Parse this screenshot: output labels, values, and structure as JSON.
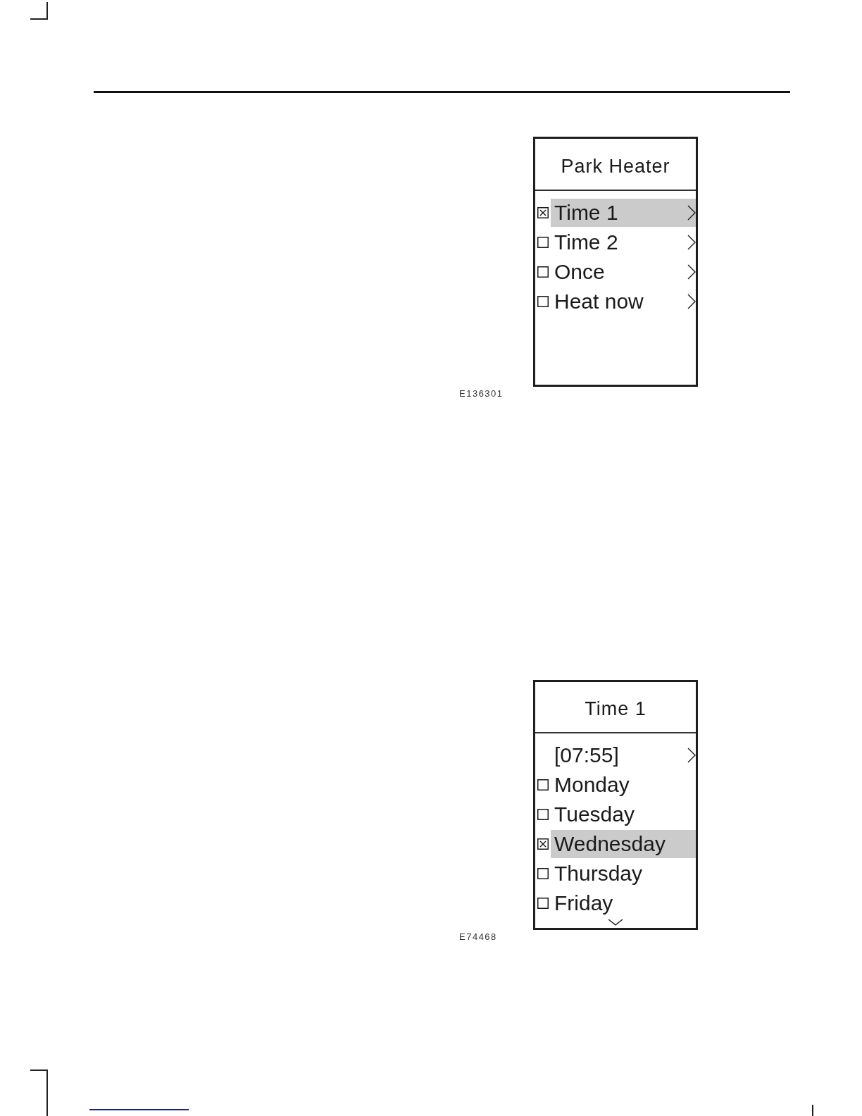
{
  "figures": [
    {
      "screen": {
        "title": "Park Heater",
        "items": [
          {
            "kind": "checkbox",
            "label": "Time 1",
            "checked": true,
            "selected": true,
            "submenu": true
          },
          {
            "kind": "checkbox",
            "label": "Time 2",
            "checked": false,
            "selected": false,
            "submenu": true
          },
          {
            "kind": "checkbox",
            "label": "Once",
            "checked": false,
            "selected": false,
            "submenu": true
          },
          {
            "kind": "checkbox",
            "label": "Heat now",
            "checked": false,
            "selected": false,
            "submenu": true
          }
        ],
        "more_below": false
      },
      "code": "E136301"
    },
    {
      "screen": {
        "title": "Time 1",
        "items": [
          {
            "kind": "value",
            "label": "[07:55]",
            "selected": false,
            "submenu": true
          },
          {
            "kind": "checkbox",
            "label": "Monday",
            "checked": false,
            "selected": false,
            "submenu": false
          },
          {
            "kind": "checkbox",
            "label": "Tuesday",
            "checked": false,
            "selected": false,
            "submenu": false
          },
          {
            "kind": "checkbox",
            "label": "Wednesday",
            "checked": true,
            "selected": true,
            "submenu": false
          },
          {
            "kind": "checkbox",
            "label": "Thursday",
            "checked": false,
            "selected": false,
            "submenu": false
          },
          {
            "kind": "checkbox",
            "label": "Friday",
            "checked": false,
            "selected": false,
            "submenu": false
          }
        ],
        "more_below": true
      },
      "code": "E74468"
    }
  ]
}
